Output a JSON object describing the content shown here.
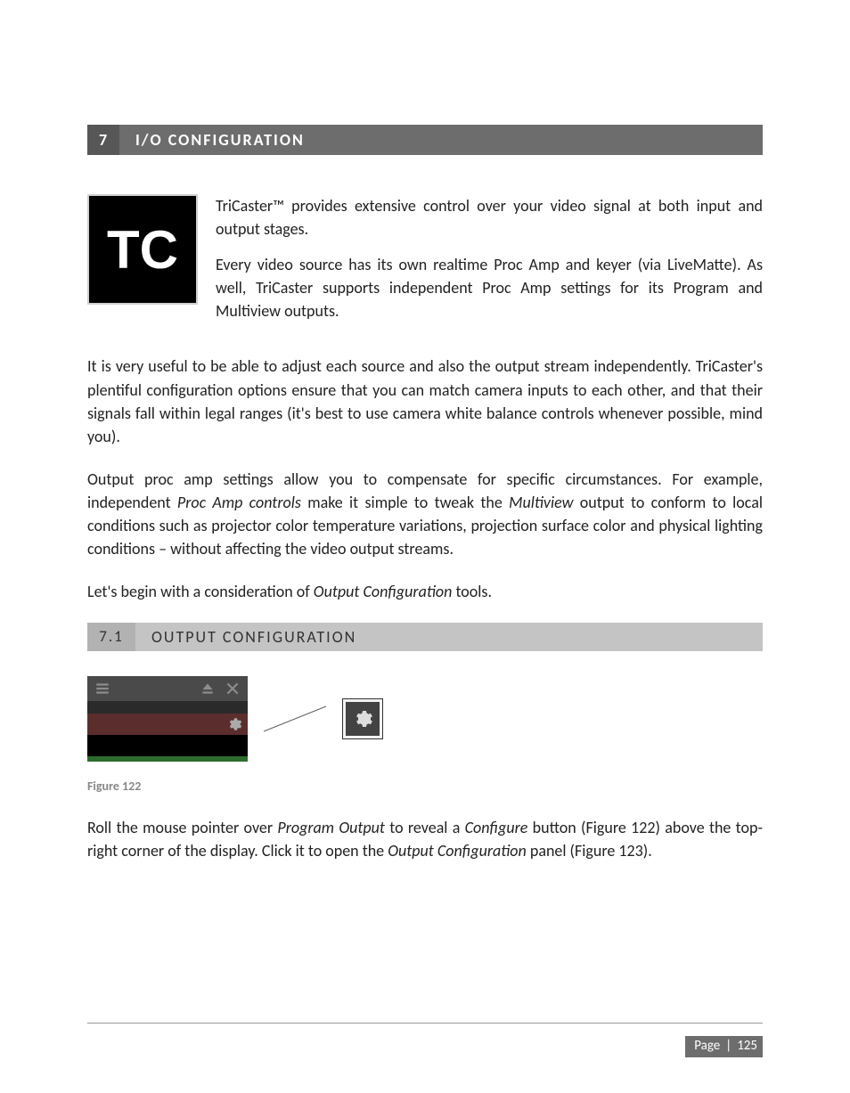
{
  "heading1": {
    "number": "7",
    "title": "I/O CONFIGURATION"
  },
  "tc_badge": "TC",
  "intro": {
    "p1": "TriCaster™ provides extensive control over your video signal at both input and output stages.",
    "p2": "Every video source has its own realtime Proc Amp and keyer (via LiveMatte). As well, TriCaster supports independent Proc Amp settings for its Program and Multiview outputs."
  },
  "body": {
    "p1": "It is very useful to be able to adjust each source and also the output stream independently. TriCaster's plentiful configuration options ensure that you can match camera inputs to each other, and that their signals fall within legal ranges (it's best to use camera white balance controls whenever possible, mind you).",
    "p2_a": "Output proc amp settings allow you to compensate for specific circumstances.  For example, independent ",
    "p2_i1": "Proc Amp controls",
    "p2_b": " make it simple to tweak the ",
    "p2_i2": "Multiview",
    "p2_c": " output to conform to local conditions such as projector color temperature variations, projection surface color and physical lighting conditions – without affecting the video output streams.",
    "p3_a": "Let's begin with a consideration of ",
    "p3_i": "Output Configuration",
    "p3_b": " tools."
  },
  "heading2": {
    "number": "7.1",
    "title": "OUTPUT CONFIGURATION"
  },
  "figure": {
    "caption": "Figure 122"
  },
  "final": {
    "a": "Roll the mouse pointer over ",
    "i1": "Program Output",
    "b": " to reveal a ",
    "i2": "Configure",
    "c": " button (Figure 122) above the top-right corner of the display.  Click it to open the ",
    "i3": "Output Configuration",
    "d": " panel (Figure 123)."
  },
  "footer": {
    "label": "Page",
    "number": "125"
  }
}
